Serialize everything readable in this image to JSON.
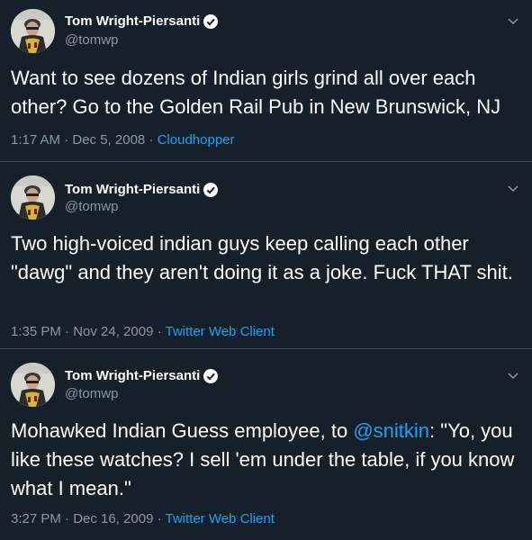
{
  "tweets": [
    {
      "name": "Tom Wright-Piersanti",
      "handle": "@tomwp",
      "text": "Want to see dozens of Indian girls grind all over each other? Go to the Golden Rail Pub in New Brunswick, NJ",
      "time": "1:17 AM · Dec 5, 2008 · ",
      "client": "Cloudhopper"
    },
    {
      "name": "Tom Wright-Piersanti",
      "handle": "@tomwp",
      "text": "Two high-voiced indian guys keep calling each other \"dawg\" and they aren't doing it as a joke. Fuck THAT shit.",
      "time": "1:35 PM · Nov 24, 2009 · ",
      "client": "Twitter Web Client"
    },
    {
      "name": "Tom Wright-Piersanti",
      "handle": "@tomwp",
      "text_before": "Mohawked Indian Guess employee, to ",
      "mention": "@snitkin",
      "text_after": ": \"Yo, you like these watches? I sell 'em under the table, if you know what I mean.\"",
      "time": "3:27 PM · Dec 16, 2009 · ",
      "client": "Twitter Web Client"
    }
  ],
  "colors": {
    "background": "#15202b",
    "secondary_text": "#8899a6",
    "link": "#1da1f2",
    "divider": "#38444d"
  }
}
